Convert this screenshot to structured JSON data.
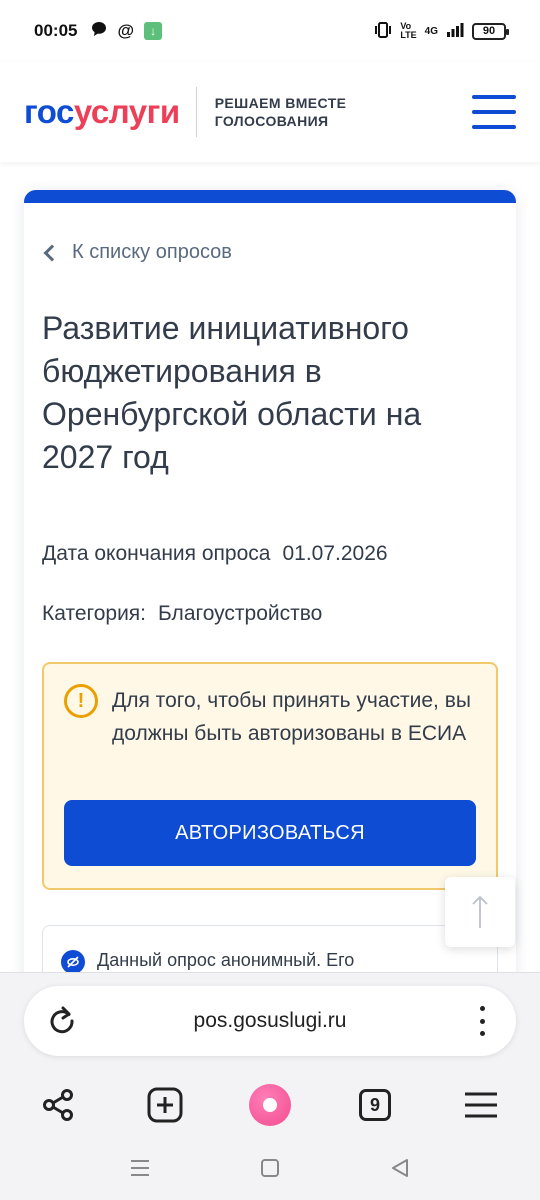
{
  "status_bar": {
    "time": "00:05",
    "battery": "90",
    "network": "4G"
  },
  "header": {
    "logo_part1": "гос",
    "logo_part2": "услуги",
    "tagline_line1": "РЕШАЕМ ВМЕСТЕ",
    "tagline_line2": "ГОЛОСОВАНИЯ",
    "brand_color": "#0d4cd3",
    "accent_color": "#ee3f58"
  },
  "survey": {
    "back_label": "К списку опросов",
    "title": "Развитие инициативного бюджетирования в Оренбургской области на 2027 год",
    "end_date_label": "Дата окончания опроса",
    "end_date": "01.07.2026",
    "category_label": "Категория:",
    "category": "Благоустройство"
  },
  "notice": {
    "icon": "exclamation-icon",
    "text": "Для того, чтобы принять участие, вы должны быть авторизованы в ЕСИА",
    "button_label": "АВТОРИЗОВАТЬСЯ",
    "bg_color": "#fff8e7",
    "border_color": "#f2c96a"
  },
  "anon": {
    "icon": "eye-crossed-icon",
    "text": "Данный опрос анонимный. Его"
  },
  "browser": {
    "url": "pos.gosuslugi.ru",
    "tabs_count": "9"
  }
}
